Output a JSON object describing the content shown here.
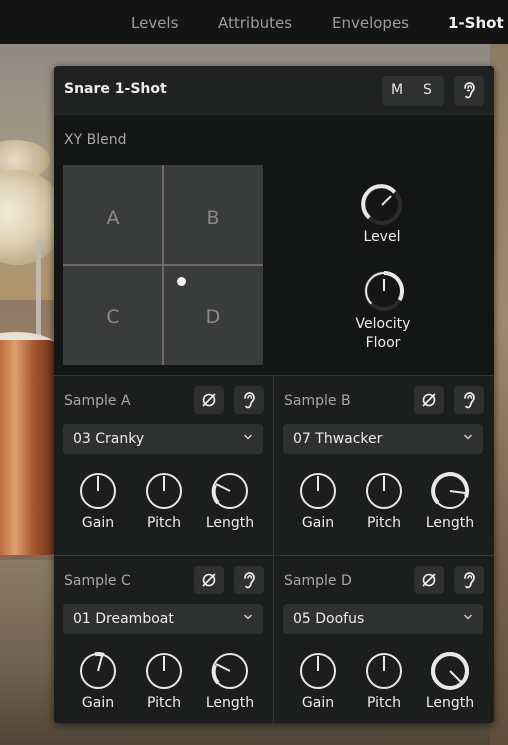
{
  "nav": {
    "tabs": [
      {
        "label": "Levels",
        "active": false
      },
      {
        "label": "Attributes",
        "active": false
      },
      {
        "label": "Envelopes",
        "active": false
      },
      {
        "label": "1-Shot",
        "active": true
      }
    ]
  },
  "panel": {
    "title": "Snare 1-Shot",
    "mute_label": "M",
    "solo_label": "S",
    "listen_icon": "ear-icon"
  },
  "xy_blend": {
    "label": "XY Blend",
    "quadrants": [
      "A",
      "B",
      "C",
      "D"
    ],
    "level_label": "Level",
    "velocity_floor_label": "Velocity\nFloor"
  },
  "samples": [
    {
      "label": "Sample A",
      "selected": "03 Cranky",
      "knobs": [
        "Gain",
        "Pitch",
        "Length"
      ]
    },
    {
      "label": "Sample B",
      "selected": "07 Thwacker",
      "knobs": [
        "Gain",
        "Pitch",
        "Length"
      ]
    },
    {
      "label": "Sample C",
      "selected": "01 Dreamboat",
      "knobs": [
        "Gain",
        "Pitch",
        "Length"
      ]
    },
    {
      "label": "Sample D",
      "selected": "05 Doofus",
      "knobs": [
        "Gain",
        "Pitch",
        "Length"
      ]
    }
  ],
  "icons": {
    "phase": "phase-invert-icon",
    "listen": "ear-icon",
    "dropdown": "chevron-down-icon"
  },
  "colors": {
    "panel_bg": "#1c1d1d",
    "knob_ring": "#e8e8e8",
    "active_tab": "#f2f2f2",
    "inactive_tab": "#9c9c9c"
  }
}
